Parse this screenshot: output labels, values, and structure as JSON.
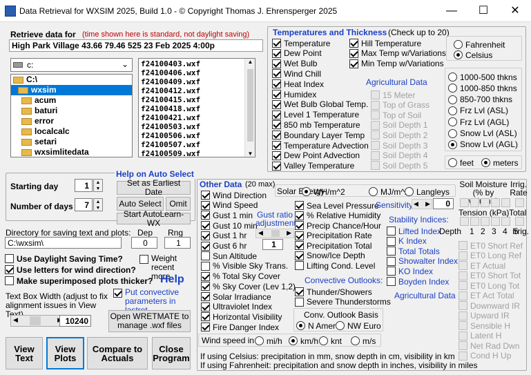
{
  "window": {
    "title": "Data Retrieval for WXSIM 2025, Build 1.0 -  © Copyright Thomas J. Ehrensperger 2025",
    "minimize": "—",
    "maximize": "☐",
    "close": "✕"
  },
  "retrieve": {
    "label": "Retrieve data for",
    "note": "(time shown here is standard, not daylight saving)",
    "station": "High Park Village   43.66  79.46  525  23 Feb  2025  4:00p"
  },
  "drive": {
    "value": "c:",
    "caret": "⌄"
  },
  "dirs": [
    "C:\\",
    "wxsim",
    "acum",
    "baturi",
    "error",
    "localcalc",
    "setari",
    "wxsimlitedata"
  ],
  "files": [
    "f24100403.wxf",
    "f24100406.wxf",
    "f24100409.wxf",
    "f24100412.wxf",
    "f24100415.wxf",
    "f24100418.wxf",
    "f24100421.wxf",
    "f24100503.wxf",
    "f24100506.wxf",
    "f24100507.wxf",
    "f24100509.wxf"
  ],
  "temps": {
    "header": "Temperatures and Thickness",
    "header_note": "(Check up to 20)",
    "left": [
      {
        "label": "Temperature",
        "on": true
      },
      {
        "label": "Dew Point",
        "on": true
      },
      {
        "label": "Wet Bulb",
        "on": true
      },
      {
        "label": "Wind Chill",
        "on": true
      },
      {
        "label": "Heat Index",
        "on": true
      },
      {
        "label": "Humidex",
        "on": true
      },
      {
        "label": "Wet Bulb Global Temp.",
        "on": true
      },
      {
        "label": "Level 1 Temperature",
        "on": true
      },
      {
        "label": "850 mb Temperature",
        "on": true
      },
      {
        "label": "Boundary Layer Temp",
        "on": true
      },
      {
        "label": "Temperature Advection",
        "on": true
      },
      {
        "label": "Dew Point Advection",
        "on": true
      },
      {
        "label": "Valley Temperature",
        "on": true
      }
    ],
    "right": [
      {
        "label": "Hill Temperature",
        "on": true
      },
      {
        "label": "Max Temp w/Variations",
        "on": true
      },
      {
        "label": "Min Temp w/Variations",
        "on": true
      }
    ],
    "ag_header": "Agricultural Data",
    "ag": [
      "15 Meter",
      "Top of Grass",
      "Top of Soil",
      "Soil Depth 1",
      "Soil Depth 2",
      "Soil Depth 3",
      "Soil Depth 4",
      "Soil Depth 5"
    ],
    "units": [
      {
        "label": "Fahrenheit",
        "on": false
      },
      {
        "label": "Celsius",
        "on": true
      }
    ],
    "thickness": [
      {
        "label": "1000-500 thkns",
        "on": false
      },
      {
        "label": "1000-850 thkns",
        "on": false
      },
      {
        "label": "850-700 thkns",
        "on": false
      },
      {
        "label": "Frz Lvl (ASL)",
        "on": false
      },
      {
        "label": "Frz Lvl (AGL)",
        "on": false
      },
      {
        "label": "Snow Lvl (ASL)",
        "on": false
      },
      {
        "label": "Snow Lvl (AGL)",
        "on": true
      }
    ],
    "height_units": [
      {
        "label": "feet",
        "on": false
      },
      {
        "label": "meters",
        "on": true
      }
    ]
  },
  "auto": {
    "header": "Help on Auto Select",
    "starting_day_label": "Starting day",
    "starting_day": "1",
    "num_days_label": "Number of days",
    "num_days": "7",
    "set_earliest": "Set as Earliest Date",
    "auto_select": "Auto Select",
    "omit": "Omit",
    "start_autolearn": "Start AutoLearn-WX"
  },
  "dir_save": {
    "label": "Directory for saving text and plots:",
    "dep_label": "Dep",
    "rng_label": "Rng",
    "path": "C:\\wxsim\\",
    "dep": "0",
    "rng": "1"
  },
  "options": [
    {
      "label": "Use Daylight Saving Time?",
      "on": false
    },
    {
      "label": "Use letters for wind direction?",
      "on": true
    },
    {
      "label": "Make superimposed plots thicker?",
      "on": false
    }
  ],
  "weight": {
    "label": "Weight recent more",
    "on": false
  },
  "help_link": "Help",
  "textbox": {
    "label": "Text Box Width (adjust to fix alignment issues in View Text)",
    "value": "10240"
  },
  "convective": {
    "label": "Put convective parameters in lastret",
    "on": true
  },
  "open_wretmate": "Open WRETMATE to manage .wxf files",
  "bottom_buttons": {
    "view_text": "View Text",
    "view_plots": "View Plots",
    "compare": "Compare to Actuals",
    "close": "Close Program"
  },
  "other": {
    "header": "Other Data",
    "header_note": "(20 max)",
    "col1": [
      {
        "label": "Wind Direction",
        "on": true
      },
      {
        "label": "Wind Speed",
        "on": true
      },
      {
        "label": "Gust 1 min",
        "on": true
      },
      {
        "label": "Gust 10 min",
        "on": true
      },
      {
        "label": "Gust 1 hr",
        "on": true
      },
      {
        "label": "Gust 6 hr",
        "on": true
      },
      {
        "label": "Sun Altitude",
        "on": false
      },
      {
        "label": "% Visible Sky Trans.",
        "on": false
      },
      {
        "label": "% Total Sky Cover",
        "on": true
      },
      {
        "label": "% Sky Cover (Lev 1,2)",
        "on": true
      },
      {
        "label": "Solar Irradiance",
        "on": true
      },
      {
        "label": "Ultraviolet Index",
        "on": true
      },
      {
        "label": "Horizontal Visibility",
        "on": true
      },
      {
        "label": "Fire Danger Index",
        "on": true
      }
    ],
    "gust_ratio_label": "Gust ratio adjustment",
    "gust_ratio": "1",
    "solar_label": "Solar Energy",
    "solar_units": [
      {
        "label": "WH/m^2",
        "on": true
      },
      {
        "label": "MJ/m^2",
        "on": false
      },
      {
        "label": "Langleys",
        "on": false
      }
    ],
    "col2": [
      {
        "label": "Sea Level Pressure",
        "on": true
      },
      {
        "label": "% Relative Humidity",
        "on": true
      },
      {
        "label": "Precip Chance/Hour",
        "on": true
      },
      {
        "label": "Precipitation Rate",
        "on": true
      },
      {
        "label": "Precipitation Total",
        "on": true
      },
      {
        "label": "Snow/Ice Depth",
        "on": true
      },
      {
        "label": "Lifting Cond. Level",
        "on": false
      }
    ],
    "sensitivity_label": "Sensitivity",
    "sensitivity": "0",
    "stability_header": "Stability Indices:",
    "stability": [
      "Lifted Index",
      "K Index",
      "Total Totals",
      "Showalter Index",
      "KO Index",
      "Boyden Index"
    ],
    "depth_label": "Depth",
    "depths": [
      "1",
      "2",
      "3",
      "4",
      "5"
    ],
    "conv_header": "Convective Outlooks:",
    "conv": [
      {
        "label": "Thunder/Showers",
        "on": true
      },
      {
        "label": "Severe Thunderstorms",
        "on": false
      }
    ],
    "ag_link": "Agricultural Data",
    "soil_header": "Soil Moisture (% by volume)",
    "irrig_rate": "Irrig. Rate",
    "tension_header": "Tension (kPa)",
    "total_label": "Total",
    "irrig_label": "Irrig.",
    "energy": [
      "ET0 Short Ref",
      "ET0 Long Ref",
      "ET Actual",
      "ET0 Short Tot",
      "ET0 Long Tot",
      "ET Act Total",
      "Downward IR",
      "Upward IR",
      "Sensible H",
      "Latent H",
      "Net Rad Dwn",
      "Cond H Up"
    ],
    "basis_header": "Conv. Outlook Basis",
    "basis": [
      {
        "label": "N Amer",
        "on": true
      },
      {
        "label": "NW Euro",
        "on": false
      }
    ],
    "wind_label": "Wind speed in",
    "wind_units": [
      {
        "label": "mi/h",
        "on": false
      },
      {
        "label": "km/h",
        "on": true
      },
      {
        "label": "knt",
        "on": false
      },
      {
        "label": "m/s",
        "on": false
      }
    ],
    "note1": "If using Celsius: precipitation in mm, snow depth in cm, visibility in km",
    "note2": "If using Fahrenheit: precipitation and snow depth in inches, visibility in miles"
  }
}
